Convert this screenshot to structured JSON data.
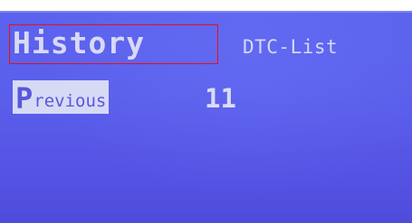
{
  "screen": {
    "title": "History",
    "tab": "DTC-List",
    "menu": {
      "selected_item_first_letter": "P",
      "selected_item_rest": "revious",
      "value": "11"
    }
  },
  "colors": {
    "lcd_background": "#5a5feb",
    "text": "#d9d9f6",
    "selection_background": "#d7daf4",
    "selection_text": "#5758dc",
    "annotation_box": "#e8101a"
  }
}
